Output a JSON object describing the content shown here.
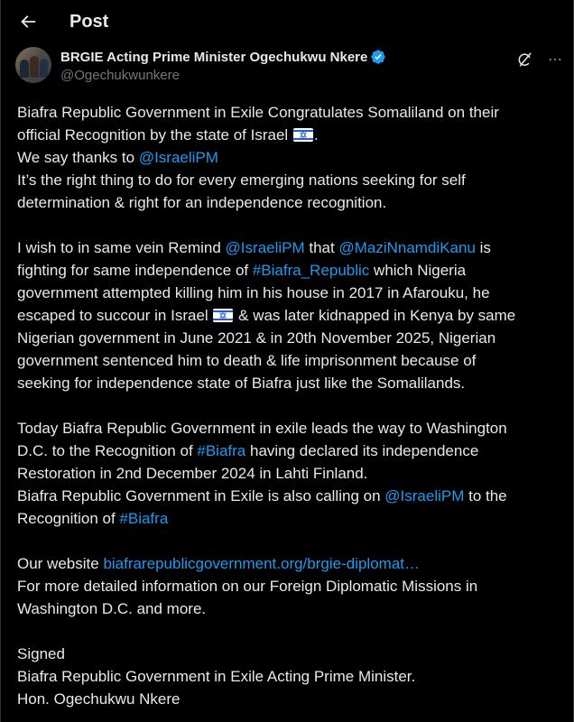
{
  "header": {
    "title": "Post"
  },
  "author": {
    "display_name": "BRGIE Acting Prime Minister Ogechukwu Nkere",
    "handle": "@Ogechukwunkere"
  },
  "colors": {
    "link": "#1d9bf0",
    "verified": "#1d9bf0",
    "text": "#e7e9ea",
    "muted": "#71767b",
    "background": "#000000"
  },
  "icons": {
    "back": "arrow-left-icon",
    "verified": "verified-badge-icon",
    "grok": "grok-icon",
    "more": "more-icon",
    "flag": "israel-flag-icon"
  },
  "post": {
    "p1": {
      "l1": "Biafra Republic Government in Exile Congratulates Somaliland on their",
      "l2": "official Recognition by the state of Israel",
      "l2_end": ".",
      "l3_pre": "We say thanks to ",
      "l3_link": "@IsraeliPM",
      "l4": "It’s the right thing to do for every emerging nations seeking for self",
      "l5": "determination & right for an independence recognition."
    },
    "p2": {
      "l1_pre": "I wish to in same vein Remind ",
      "l1_link1": "@IsraeliPM",
      "l1_mid": " that ",
      "l1_link2": "@MaziNnamdiKanu",
      "l1_post": " is",
      "l2_pre": "fighting for same independence of ",
      "l2_link": "#Biafra_Republic",
      "l2_post": " which Nigeria",
      "l3": "government attempted killing him in his house in 2017 in Afarouku, he",
      "l4_pre": "escaped to succour in Israel ",
      "l4_post": " & was later kidnapped in Kenya by same",
      "l5": "Nigerian government in June 2021 & in 20th November 2025, Nigerian",
      "l6": "government sentenced him to death & life imprisonment because of",
      "l7": "seeking for independence state of Biafra just like the Somalilands."
    },
    "p3": {
      "l1": "Today Biafra Republic Government in exile leads the way to Washington",
      "l2_pre": "D.C. to the Recognition of ",
      "l2_link": "#Biafra",
      "l2_post": " having declared its independence",
      "l3": "Restoration in 2nd December 2024 in Lahti Finland.",
      "l4_pre": "Biafra Republic Government in Exile is also calling on ",
      "l4_link": "@IsraeliPM",
      "l4_post": " to the",
      "l5_pre": "Recognition of ",
      "l5_link": "#Biafra"
    },
    "p4": {
      "l1_pre": "Our website ",
      "l1_link": "biafrarepublicgovernment.org/brgie-diplomat…",
      "l2": "For more detailed information on our Foreign Diplomatic Missions in",
      "l3": "Washington D.C. and more."
    },
    "p5": {
      "l1": "Signed",
      "l2": "Biafra Republic Government in Exile Acting Prime Minister.",
      "l3": "Hon. Ogechukwu Nkere"
    }
  }
}
